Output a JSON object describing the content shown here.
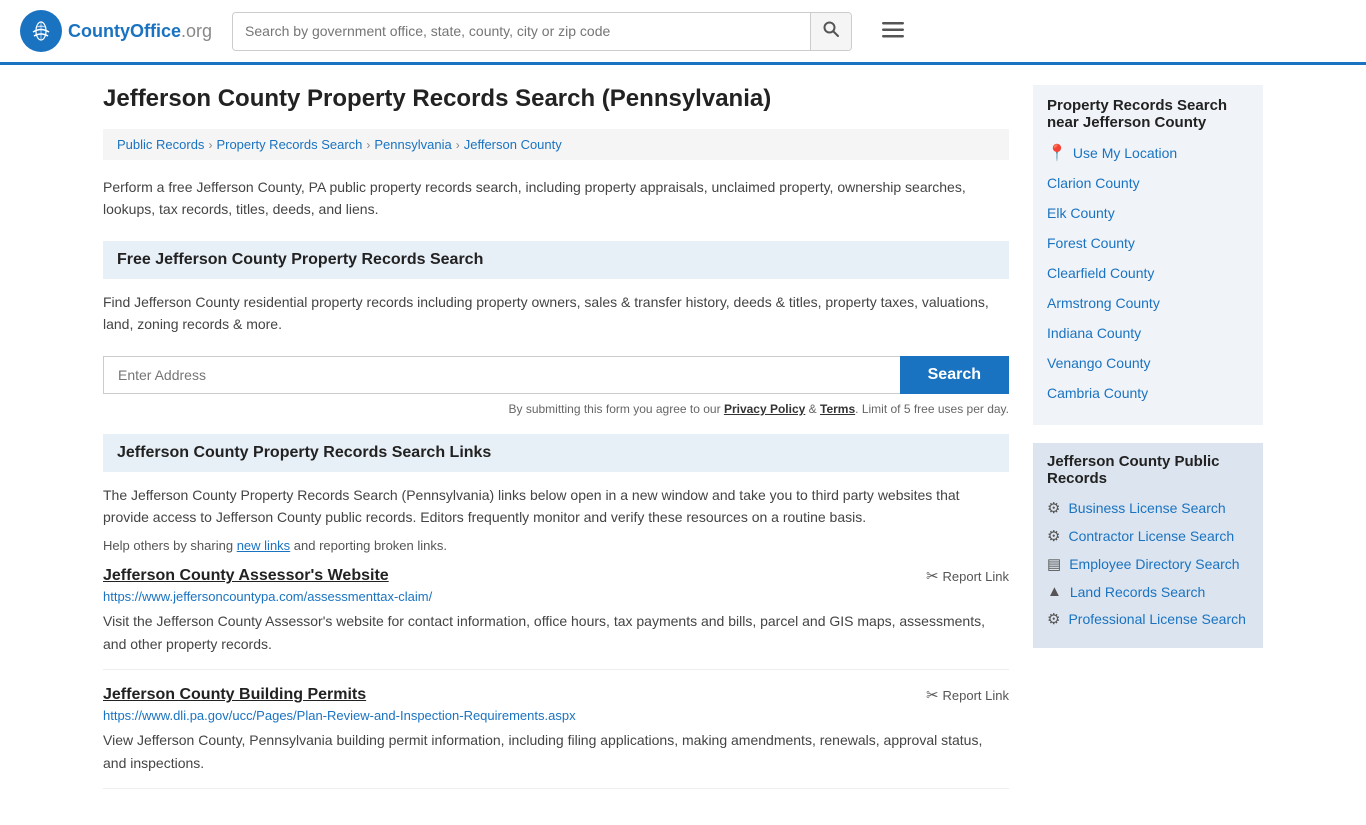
{
  "header": {
    "logo_text": "CountyOffice",
    "logo_suffix": ".org",
    "search_placeholder": "Search by government office, state, county, city or zip code"
  },
  "page": {
    "title": "Jefferson County Property Records Search (Pennsylvania)",
    "breadcrumbs": [
      {
        "label": "Public Records",
        "href": "#"
      },
      {
        "label": "Property Records Search",
        "href": "#"
      },
      {
        "label": "Pennsylvania",
        "href": "#"
      },
      {
        "label": "Jefferson County",
        "href": "#"
      }
    ],
    "description": "Perform a free Jefferson County, PA public property records search, including property appraisals, unclaimed property, ownership searches, lookups, tax records, titles, deeds, and liens.",
    "free_search": {
      "heading": "Free Jefferson County Property Records Search",
      "description": "Find Jefferson County residential property records including property owners, sales & transfer history, deeds & titles, property taxes, valuations, land, zoning records & more.",
      "address_placeholder": "Enter Address",
      "search_button": "Search",
      "disclaimer": "By submitting this form you agree to our",
      "privacy_policy": "Privacy Policy",
      "terms": "Terms",
      "limit_text": "Limit of 5 free uses per day."
    },
    "links_section": {
      "heading": "Jefferson County Property Records Search Links",
      "description": "The Jefferson County Property Records Search (Pennsylvania) links below open in a new window and take you to third party websites that provide access to Jefferson County public records. Editors frequently monitor and verify these resources on a routine basis.",
      "help_text": "Help others by sharing",
      "new_links_text": "new links",
      "reporting_text": "and reporting broken links.",
      "links": [
        {
          "title": "Jefferson County Assessor's Website",
          "url": "https://www.jeffersoncountypa.com/assessmenttax-claim/",
          "description": "Visit the Jefferson County Assessor's website for contact information, office hours, tax payments and bills, parcel and GIS maps, assessments, and other property records."
        },
        {
          "title": "Jefferson County Building Permits",
          "url": "https://www.dli.pa.gov/ucc/Pages/Plan-Review-and-Inspection-Requirements.aspx",
          "description": "View Jefferson County, Pennsylvania building permit information, including filing applications, making amendments, renewals, approval status, and inspections."
        }
      ]
    }
  },
  "sidebar": {
    "nearby_section": {
      "title": "Property Records Search near Jefferson County",
      "use_my_location": "Use My Location",
      "counties": [
        "Clarion County",
        "Elk County",
        "Forest County",
        "Clearfield County",
        "Armstrong County",
        "Indiana County",
        "Venango County",
        "Cambria County"
      ]
    },
    "public_records_section": {
      "title": "Jefferson County Public Records",
      "links": [
        {
          "label": "Business License Search",
          "icon": "⚙"
        },
        {
          "label": "Contractor License Search",
          "icon": "⚙"
        },
        {
          "label": "Employee Directory Search",
          "icon": "▤"
        },
        {
          "label": "Land Records Search",
          "icon": "▲"
        },
        {
          "label": "Professional License Search",
          "icon": "⚙"
        }
      ]
    }
  }
}
